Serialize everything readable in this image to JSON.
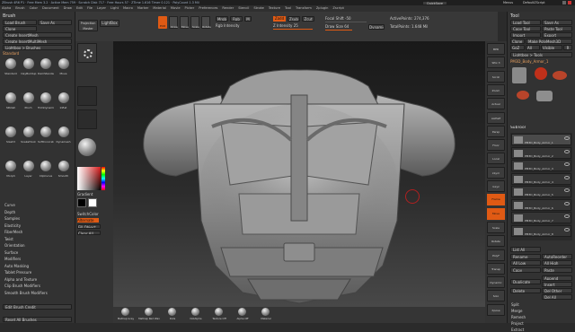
{
  "status": {
    "line": "ZBrush 4R6 P1 · Free Mem 3.2 · Active Mem 759 · Scratch Disk 717 · Free Hours 57 · ZTime 1.616 Timer 0.121 · PolyCount 1.3 Mil",
    "quicksave": "QuickSave",
    "menus": "Menus",
    "script": "DefaultZScript"
  },
  "menus": [
    "Alpha",
    "Brush",
    "Color",
    "Document",
    "Draw",
    "Edit",
    "File",
    "Layer",
    "Light",
    "Macro",
    "Marker",
    "Material",
    "Movie",
    "Picker",
    "Preferences",
    "Render",
    "Stencil",
    "Stroke",
    "Texture",
    "Tool",
    "Transform",
    "Zplugin",
    "Zscript"
  ],
  "brush_panel": {
    "title": "Brush",
    "buttons": [
      "Load Brush",
      "Save As",
      "Clone",
      "Create InsertMesh",
      "Create InsertMultiMesh",
      "Lightbox > Brushes"
    ],
    "current": "Standard",
    "brushes": [
      "Standard",
      "ClayBuildup",
      "DamStandard",
      "Move",
      "hPolish",
      "Pinch",
      "TrimDynamic",
      "Inflat",
      "Slash3",
      "SnakeHook",
      "SoftConcrete",
      "Dynamesh",
      "Morph",
      "Layer",
      "ClipCurve",
      "Smooth"
    ],
    "sections": [
      "Curve",
      "Depth",
      "Samples",
      "Elasticity",
      "FiberMesh",
      "Twist",
      "Orientation",
      "Surface",
      "Modifiers",
      "Auto Masking",
      "Tablet Pressure",
      "Alpha and Texture",
      "Clip Brush Modifiers",
      "Smooth Brush Modifiers"
    ],
    "footer": [
      "Edit Brush Credit",
      "Reset All Brushes"
    ]
  },
  "left_shelf": {
    "projection_master": "Projection Master",
    "lightbox": "LightBox",
    "gradient": "Gradient",
    "switch_color": "SwitchColor",
    "alternate": "Alternate",
    "fill_object": "Fill Object",
    "clear": "Clear All"
  },
  "tool_shelf": {
    "modes": [
      "Edit",
      "Draw",
      "Move",
      "Scale",
      "Rotate"
    ],
    "mrgb": "Mrgb",
    "rgb": "Rgb",
    "m": "M",
    "zadd": "Zadd",
    "zsub": "Zsub",
    "zcut": "Zcut",
    "rgb_intensity": "Rgb Intensity",
    "z_intensity": "Z Intensity 25",
    "focal_shift": "Focal Shift -50",
    "draw_size": "Draw Size 64",
    "dynamic": "Dynamic",
    "active_points": "ActivePoints: 274,376",
    "total_points": "TotalPoints: 1.648 Mil"
  },
  "right_shelf": [
    "BPR",
    "SPix 3",
    "Scroll",
    "Zoom",
    "Actual",
    "AAHalf",
    "Persp",
    "Floor",
    "Local",
    "LSym",
    "Gxyz",
    "Frame",
    "Move",
    "Scale",
    "Rotate",
    "PolyF",
    "Transp",
    "Dynamic",
    "Solo",
    "Xpose"
  ],
  "bottom_shelf": [
    "MatCap Gray",
    "MatCap Red Wax",
    "Dots",
    "DotAlpha",
    "Texture Off",
    "Alpha Off",
    "Material"
  ],
  "tool_panel": {
    "title": "Tool",
    "buttons": [
      "Load Tool",
      "Save As",
      "Copy Tool",
      "Paste Tool",
      "Import",
      "Export",
      "Clone",
      "Make PolyMesh3D",
      "GoZ",
      "All",
      "Visible",
      "R"
    ],
    "lightbox_tools": "Lightbox > Tools",
    "current_tool": "PM3D_Body_Armor_1",
    "subtool": {
      "title": "SubTool",
      "items": [
        "PM3D_Body_Armor_1",
        "PM3D_Body_Armor_2",
        "PM3D_Body_Armor_3",
        "PM3D_Body_Armor_4",
        "PM3D_Body_Armor_5",
        "PM3D_Body_Armor_6",
        "PM3D_Body_Armor_7",
        "PM3D_Body_Armor_8"
      ]
    },
    "list_all": "List All",
    "rename": "Rename",
    "auto_reorder": "AutoReorder",
    "all_low": "All Low",
    "all_high": "All High",
    "copy": "Copy",
    "paste": "Paste",
    "duplicate": "Duplicate",
    "append": "Append",
    "insert": "Insert",
    "delete": "Delete",
    "del_other": "Del Other",
    "del_all": "Del All",
    "split": "Split",
    "merge": "Merge",
    "remesh": "Remesh",
    "project": "Project",
    "extract": "Extract"
  },
  "colors": {
    "accent": "#e05a14",
    "panel": "#323232",
    "viewport_top": "#191919",
    "viewport_bottom": "#4a4a4a",
    "mesh": "#8f8f8f"
  }
}
